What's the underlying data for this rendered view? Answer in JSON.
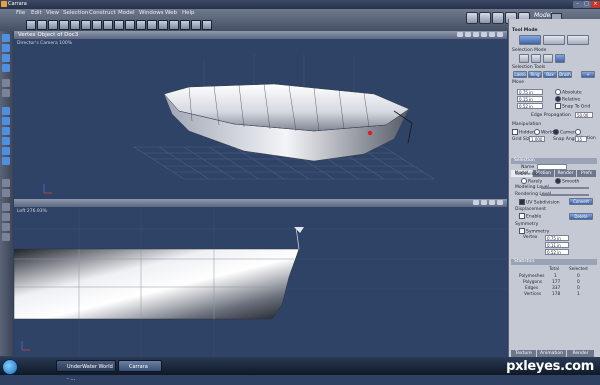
{
  "window": {
    "title": "Carrara"
  },
  "menu": {
    "items": [
      "File",
      "Edit",
      "View",
      "Selection",
      "Construct",
      "Model",
      "Windows",
      "Web",
      "Help"
    ]
  },
  "header": {
    "mode": "Model"
  },
  "viewports": {
    "top": {
      "title": "Vertex Object of Doc3",
      "camera": "Director's Camera 100%"
    },
    "bottom": {
      "camera": "Left 276.93%"
    }
  },
  "panel": {
    "tabs": [
      "Model",
      "Motion",
      "Render",
      "Prefs"
    ],
    "tool_mode": "Tool Mode",
    "selection_mode": "Selection Mode",
    "selection_tools": "Selection Tools",
    "sel_buttons": [
      "Lasso",
      "Ring",
      "Box",
      "Brush",
      "+"
    ],
    "move": "Move",
    "fields": {
      "x": "0.75 in",
      "y": "0.15 in",
      "z": "0.52 in"
    },
    "radio_options": [
      "Absolute",
      "Relative",
      "Snap To Grid"
    ],
    "edge_propagation_label": "Edge Propagation",
    "edge_propagation_value": "50.00",
    "manipulation": "Manipulation",
    "manip_options": [
      "Hidden",
      "World",
      "Camera",
      "Selection"
    ],
    "grid_size_label": "Grid Size",
    "grid_size_value": "1.000",
    "snap_angle_label": "Snap Angle",
    "snap_angle_value": "15",
    "selection_section": "Selection",
    "name_label": "Name",
    "subdivision": "Subdivision",
    "subdiv_options": [
      "Rarely",
      "Smooth"
    ],
    "modeling_level": "Modeling Level",
    "rendering_level": "Rendering Level",
    "uv_subdivision": "UV Subdivision",
    "convert_label": "Convert",
    "displacement": "Displacement",
    "enable": "Enable",
    "delete_label": "Delete",
    "symmetry": "Symmetry",
    "symmetry_check": "Symmetry",
    "vertex_label": "Vertex",
    "vertex_fields": {
      "x": "0.75 in",
      "y": "0.11 in",
      "z": "0.52 in"
    },
    "statistics": "Statistics",
    "stats_headers": [
      "Total",
      "Selected"
    ],
    "stats_rows": [
      {
        "label": "Polymeshes",
        "total": "1",
        "selected": "0"
      },
      {
        "label": "Polygons",
        "total": "177",
        "selected": "0"
      },
      {
        "label": "Edges",
        "total": "337",
        "selected": "0"
      },
      {
        "label": "Vertices",
        "total": "178",
        "selected": "1"
      }
    ],
    "bottom_tabs": [
      "Texture",
      "Animation",
      "Render"
    ]
  },
  "taskbar": {
    "tasks": [
      "UnderWater World - ...",
      "Carrara"
    ]
  },
  "watermark": {
    "text": "pxleyes.com"
  }
}
